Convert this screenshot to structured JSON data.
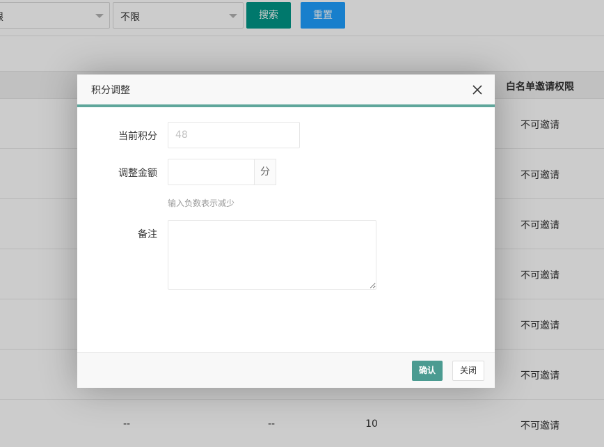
{
  "filters": {
    "select1_value": "限",
    "select2_value": "不限",
    "search_label": "搜索",
    "reset_label": "重置"
  },
  "table": {
    "header_permission": "白名单邀请权限",
    "rows": [
      {
        "permission": "不可邀请"
      },
      {
        "permission": "不可邀请"
      },
      {
        "permission": "不可邀请"
      },
      {
        "permission": "不可邀请"
      },
      {
        "permission": "不可邀请"
      },
      {
        "permission": "不可邀请"
      },
      {
        "col_a": "--",
        "col_b": "--",
        "col_c": "10",
        "permission": "不可邀请"
      }
    ]
  },
  "modal": {
    "title": "积分调整",
    "current_points_label": "当前积分",
    "current_points_value": "48",
    "amount_label": "调整金额",
    "amount_value": "",
    "amount_suffix": "分",
    "amount_hint": "输入负数表示减少",
    "remark_label": "备注",
    "remark_value": "",
    "confirm_label": "确认",
    "close_label": "关闭"
  },
  "colors": {
    "primary": "#009688",
    "reset_blue": "#1e9fff",
    "header_line": "#5fa69b"
  },
  "icons": {
    "close": "close-icon",
    "dropdown": "chevron-down-icon"
  }
}
